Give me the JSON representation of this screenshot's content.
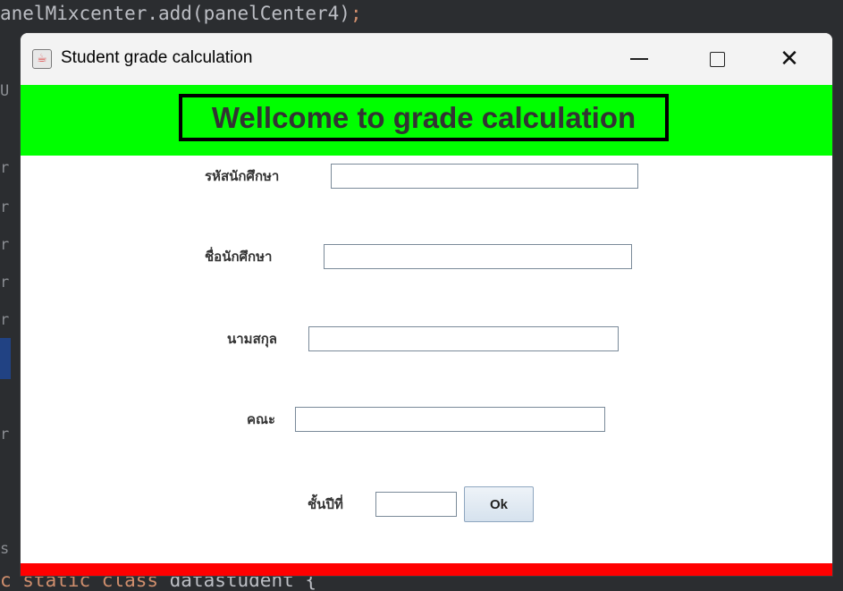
{
  "ide": {
    "top_code": "anelMixcenter.add(panelCenter4)",
    "top_punct": ";",
    "gutter_chars": [
      "U",
      "r",
      "r",
      "r",
      "r",
      "r",
      "r",
      "s"
    ],
    "bottom_keyword": "c static class ",
    "bottom_class": "datastudent {"
  },
  "window": {
    "title": "Student grade calculation",
    "icon": "java-cup-icon",
    "controls": [
      "minimize",
      "maximize",
      "close"
    ]
  },
  "header": {
    "title": "Wellcome to grade calculation",
    "background": "#00ff00"
  },
  "form": {
    "fields": [
      {
        "label": "รหัสนักศึกษา",
        "value": ""
      },
      {
        "label": "ชื่อนักศึกษา",
        "value": ""
      },
      {
        "label": "นามสกุล",
        "value": ""
      },
      {
        "label": "คณะ",
        "value": ""
      },
      {
        "label": "ชั้นปีที่",
        "value": ""
      }
    ],
    "ok_label": "Ok"
  },
  "footer": {
    "background": "#ff0000"
  }
}
